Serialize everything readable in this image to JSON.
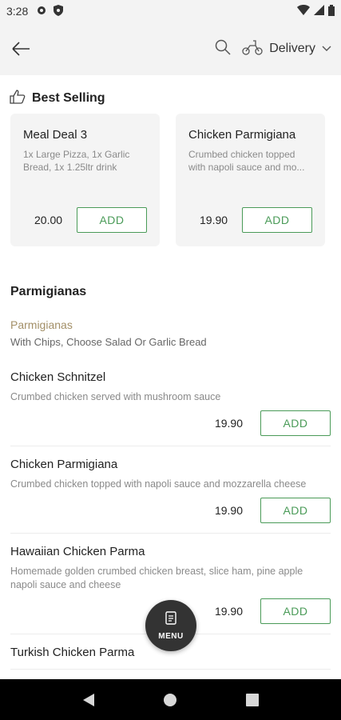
{
  "status": {
    "time": "3:28"
  },
  "header": {
    "delivery_label": "Delivery"
  },
  "best_selling": {
    "title": "Best Selling",
    "items": [
      {
        "name": "Meal Deal 3",
        "desc": "1x Large Pizza, 1x Garlic Bread, 1x 1.25ltr drink",
        "price": "20.00",
        "add_label": "ADD"
      },
      {
        "name": "Chicken Parmigiana",
        "desc": "Crumbed chicken topped with napoli sauce and mo...",
        "price": "19.90",
        "add_label": "ADD"
      }
    ]
  },
  "category": {
    "title": "Parmigianas",
    "subtitle": "Parmigianas",
    "note": "With Chips, Choose Salad Or Garlic Bread",
    "items": [
      {
        "name": "Chicken Schnitzel",
        "desc": "Crumbed chicken served with mushroom sauce",
        "price": "19.90",
        "add_label": "ADD"
      },
      {
        "name": "Chicken Parmigiana",
        "desc": "Crumbed chicken topped with napoli sauce and mozzarella cheese",
        "price": "19.90",
        "add_label": "ADD"
      },
      {
        "name": "Hawaiian Chicken Parma",
        "desc": "Homemade golden crumbed chicken breast, slice ham, pine apple napoli sauce and cheese",
        "price": "19.90",
        "add_label": "ADD"
      },
      {
        "name": "Turkish Chicken Parma",
        "desc": "",
        "price": "",
        "add_label": ""
      }
    ]
  },
  "fab": {
    "label": "MENU"
  },
  "colors": {
    "accent": "#4a9b58",
    "subtitle": "#a38f67",
    "fab": "#333333"
  }
}
